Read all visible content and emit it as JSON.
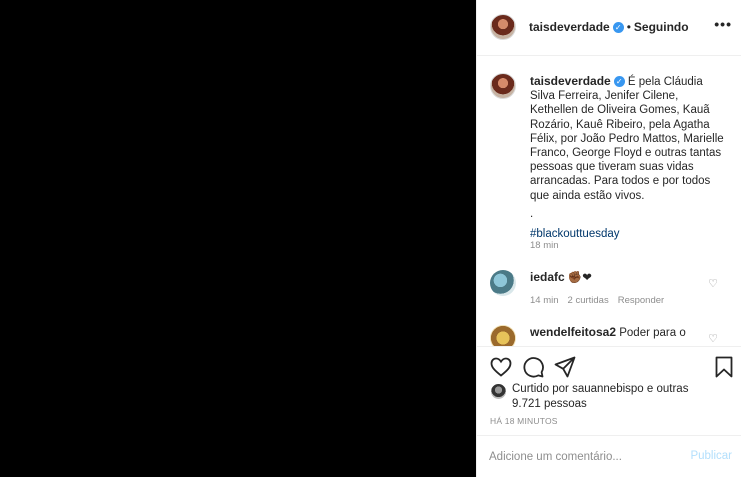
{
  "post": {
    "username": "taisdeverdade",
    "following_label": "Seguindo",
    "more_icon": "more-horizontal-icon"
  },
  "caption": {
    "username": "taisdeverdade",
    "text": "É pela Cláudia Silva Ferreira, Jenifer Cilene, Kethellen de Oliveira Gomes, Kauã Rozário, Kauê Ribeiro, pela Agatha Félix, por João Pedro Mattos, Marielle Franco, George Floyd e outras tantas pessoas que tiveram suas vidas arrancadas. Para todos e por todos que ainda estão vivos.",
    "dot": ".",
    "hashtag": "#blackouttuesday",
    "time": "18 min"
  },
  "comments": [
    {
      "username": "iedafc",
      "text": "✊🏾❤",
      "time": "14 min",
      "likes": "2 curtidas",
      "reply_label": "Responder"
    },
    {
      "username": "wendelfeitosa2",
      "text": "Poder para o"
    }
  ],
  "likes": {
    "text": "Curtido por sauannebispo e outras 9.721 pessoas"
  },
  "posted_ago": "HÁ 18 MINUTOS",
  "comment_input": {
    "placeholder": "Adicione um comentário...",
    "publish_label": "Publicar"
  },
  "colors": {
    "link": "#00376b",
    "verified": "#3897f0",
    "muted": "#8e8e8e",
    "publish_disabled": "#b2dffc"
  }
}
